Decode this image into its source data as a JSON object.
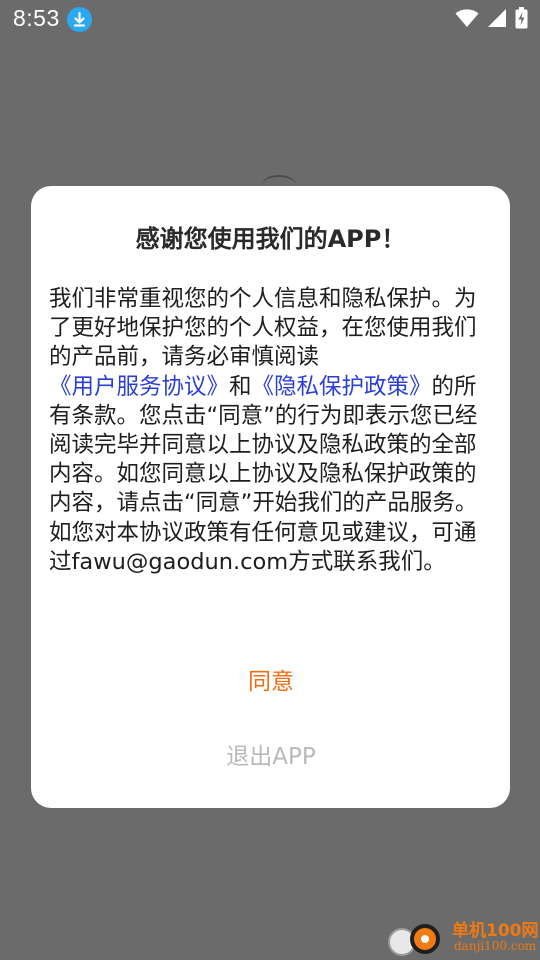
{
  "status_bar": {
    "time": "8:53",
    "notification_icon": "download-icon",
    "icons": [
      "wifi-icon",
      "signal-icon",
      "battery-charging-icon"
    ]
  },
  "dialog": {
    "title": "感谢您使用我们的APP！",
    "body": {
      "part1": "我们非常重视您的个人信息和隐私保护。为了更好地保护您的个人权益，在您使用我们的产品前，请务必审慎阅读",
      "link_user_agreement": "《用户服务协议》",
      "and": "和",
      "link_privacy_policy": "《隐私保护政策》",
      "part2": "的所有条款。您点击“同意”的行为即表示您已经阅读完毕并同意以上协议及隐私政策的全部内容。如您同意以上协议及隐私保护政策的内容，请点击“同意”开始我们的产品服务。",
      "part3": "如您对本协议政策有任何意见或建议，可通过fawu@gaodun.com方式联系我们。"
    },
    "agree_label": "同意",
    "exit_label": "退出APP"
  },
  "watermark": {
    "name": "单机100网",
    "domain": "danji100.com"
  },
  "colors": {
    "overlay": "#6b6b6b",
    "link": "#2b3fd4",
    "agree": "#f36c14",
    "exit": "#b9b9b9"
  }
}
